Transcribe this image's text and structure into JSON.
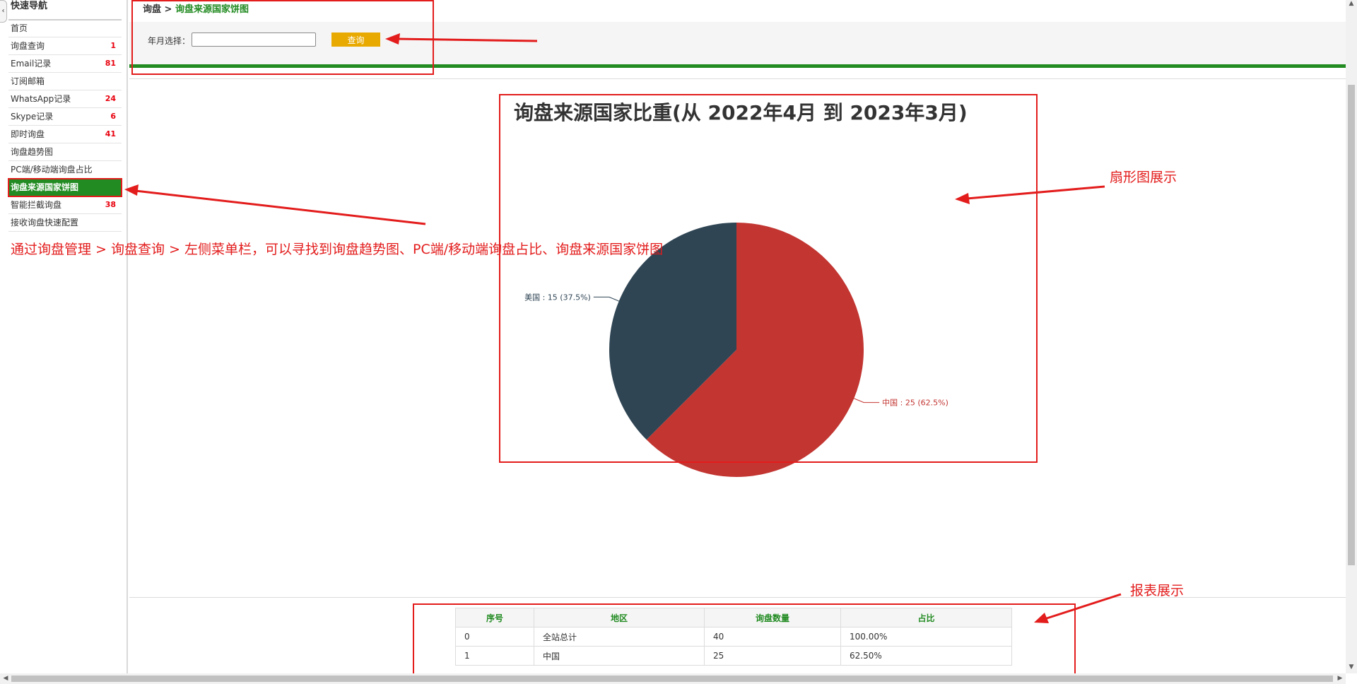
{
  "sidebar": {
    "tab_glyph": "‹",
    "title": "快速导航",
    "items": [
      {
        "label": "首页",
        "count": ""
      },
      {
        "label": "询盘查询",
        "count": "1"
      },
      {
        "label": "Email记录",
        "count": "81"
      },
      {
        "label": "订阅邮箱",
        "count": ""
      },
      {
        "label": "WhatsApp记录",
        "count": "24"
      },
      {
        "label": "Skype记录",
        "count": "6"
      },
      {
        "label": "即时询盘",
        "count": "41"
      },
      {
        "label": "询盘趋势图",
        "count": ""
      },
      {
        "label": "PC端/移动端询盘占比",
        "count": ""
      },
      {
        "label": "询盘来源国家饼图",
        "count": "",
        "active": true
      },
      {
        "label": "智能拦截询盘",
        "count": "38"
      },
      {
        "label": "接收询盘快速配置",
        "count": ""
      }
    ]
  },
  "breadcrumb": {
    "root": "询盘",
    "separator": " > ",
    "current": "询盘来源国家饼图"
  },
  "filter": {
    "label": "年月选择：",
    "input_value": "",
    "button_label": "查询"
  },
  "chart_data": {
    "type": "pie",
    "title": "询盘来源国家比重(从 2022年4月 到 2023年3月)",
    "slices": [
      {
        "name": "中国",
        "value": 25,
        "percent": 62.5,
        "label": "中国 : 25 (62.5%)",
        "color": "#c23531"
      },
      {
        "name": "美国",
        "value": 15,
        "percent": 37.5,
        "label": "美国 : 15 (37.5%)",
        "color": "#2f4554"
      }
    ]
  },
  "table": {
    "headers": [
      "序号",
      "地区",
      "询盘数量",
      "占比"
    ],
    "rows": [
      [
        "0",
        "全站总计",
        "40",
        "100.00%"
      ],
      [
        "1",
        "中国",
        "25",
        "62.50%"
      ]
    ]
  },
  "annotations": {
    "nav_note": "通过询盘管理 > 询盘查询 > 左侧菜单栏，可以寻找到询盘趋势图、PC端/移动端询盘占比、询盘来源国家饼图",
    "pie_note": "扇形图展示",
    "table_note": "报表展示",
    "color": "#e31c1c"
  },
  "colors": {
    "accent_green": "#228b22",
    "button_orange": "#e8a900",
    "count_red": "#e8000d"
  }
}
